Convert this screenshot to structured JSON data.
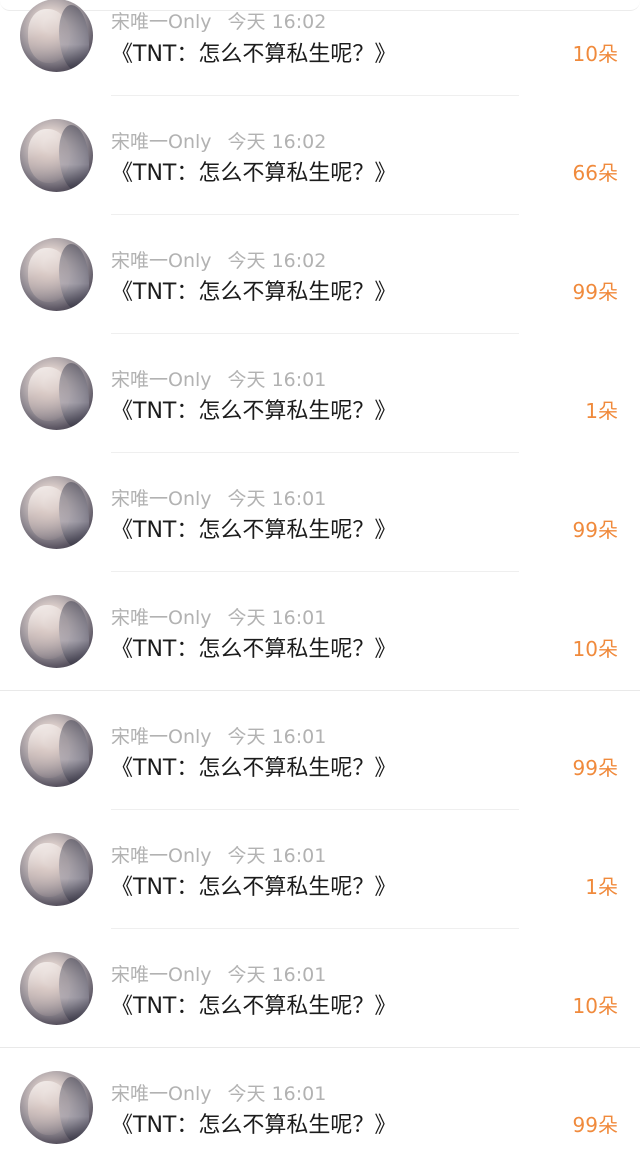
{
  "messages": [
    {
      "user": "宋唯一Only",
      "time": "今天 16:02",
      "title": "《TNT：怎么不算私生呢？》",
      "count": "10朵"
    },
    {
      "user": "宋唯一Only",
      "time": "今天 16:02",
      "title": "《TNT：怎么不算私生呢？》",
      "count": "66朵"
    },
    {
      "user": "宋唯一Only",
      "time": "今天 16:02",
      "title": "《TNT：怎么不算私生呢？》",
      "count": "99朵"
    },
    {
      "user": "宋唯一Only",
      "time": "今天 16:01",
      "title": "《TNT：怎么不算私生呢？》",
      "count": "1朵"
    },
    {
      "user": "宋唯一Only",
      "time": "今天 16:01",
      "title": "《TNT：怎么不算私生呢？》",
      "count": "99朵"
    },
    {
      "user": "宋唯一Only",
      "time": "今天 16:01",
      "title": "《TNT：怎么不算私生呢？》",
      "count": "10朵"
    },
    {
      "user": "宋唯一Only",
      "time": "今天 16:01",
      "title": "《TNT：怎么不算私生呢？》",
      "count": "99朵"
    },
    {
      "user": "宋唯一Only",
      "time": "今天 16:01",
      "title": "《TNT：怎么不算私生呢？》",
      "count": "1朵"
    },
    {
      "user": "宋唯一Only",
      "time": "今天 16:01",
      "title": "《TNT：怎么不算私生呢？》",
      "count": "10朵"
    },
    {
      "user": "宋唯一Only",
      "time": "今天 16:01",
      "title": "《TNT：怎么不算私生呢？》",
      "count": "99朵"
    }
  ],
  "colors": {
    "count": "#f08a3c",
    "meta": "#b2b2b2",
    "title": "#1c1c1c"
  }
}
